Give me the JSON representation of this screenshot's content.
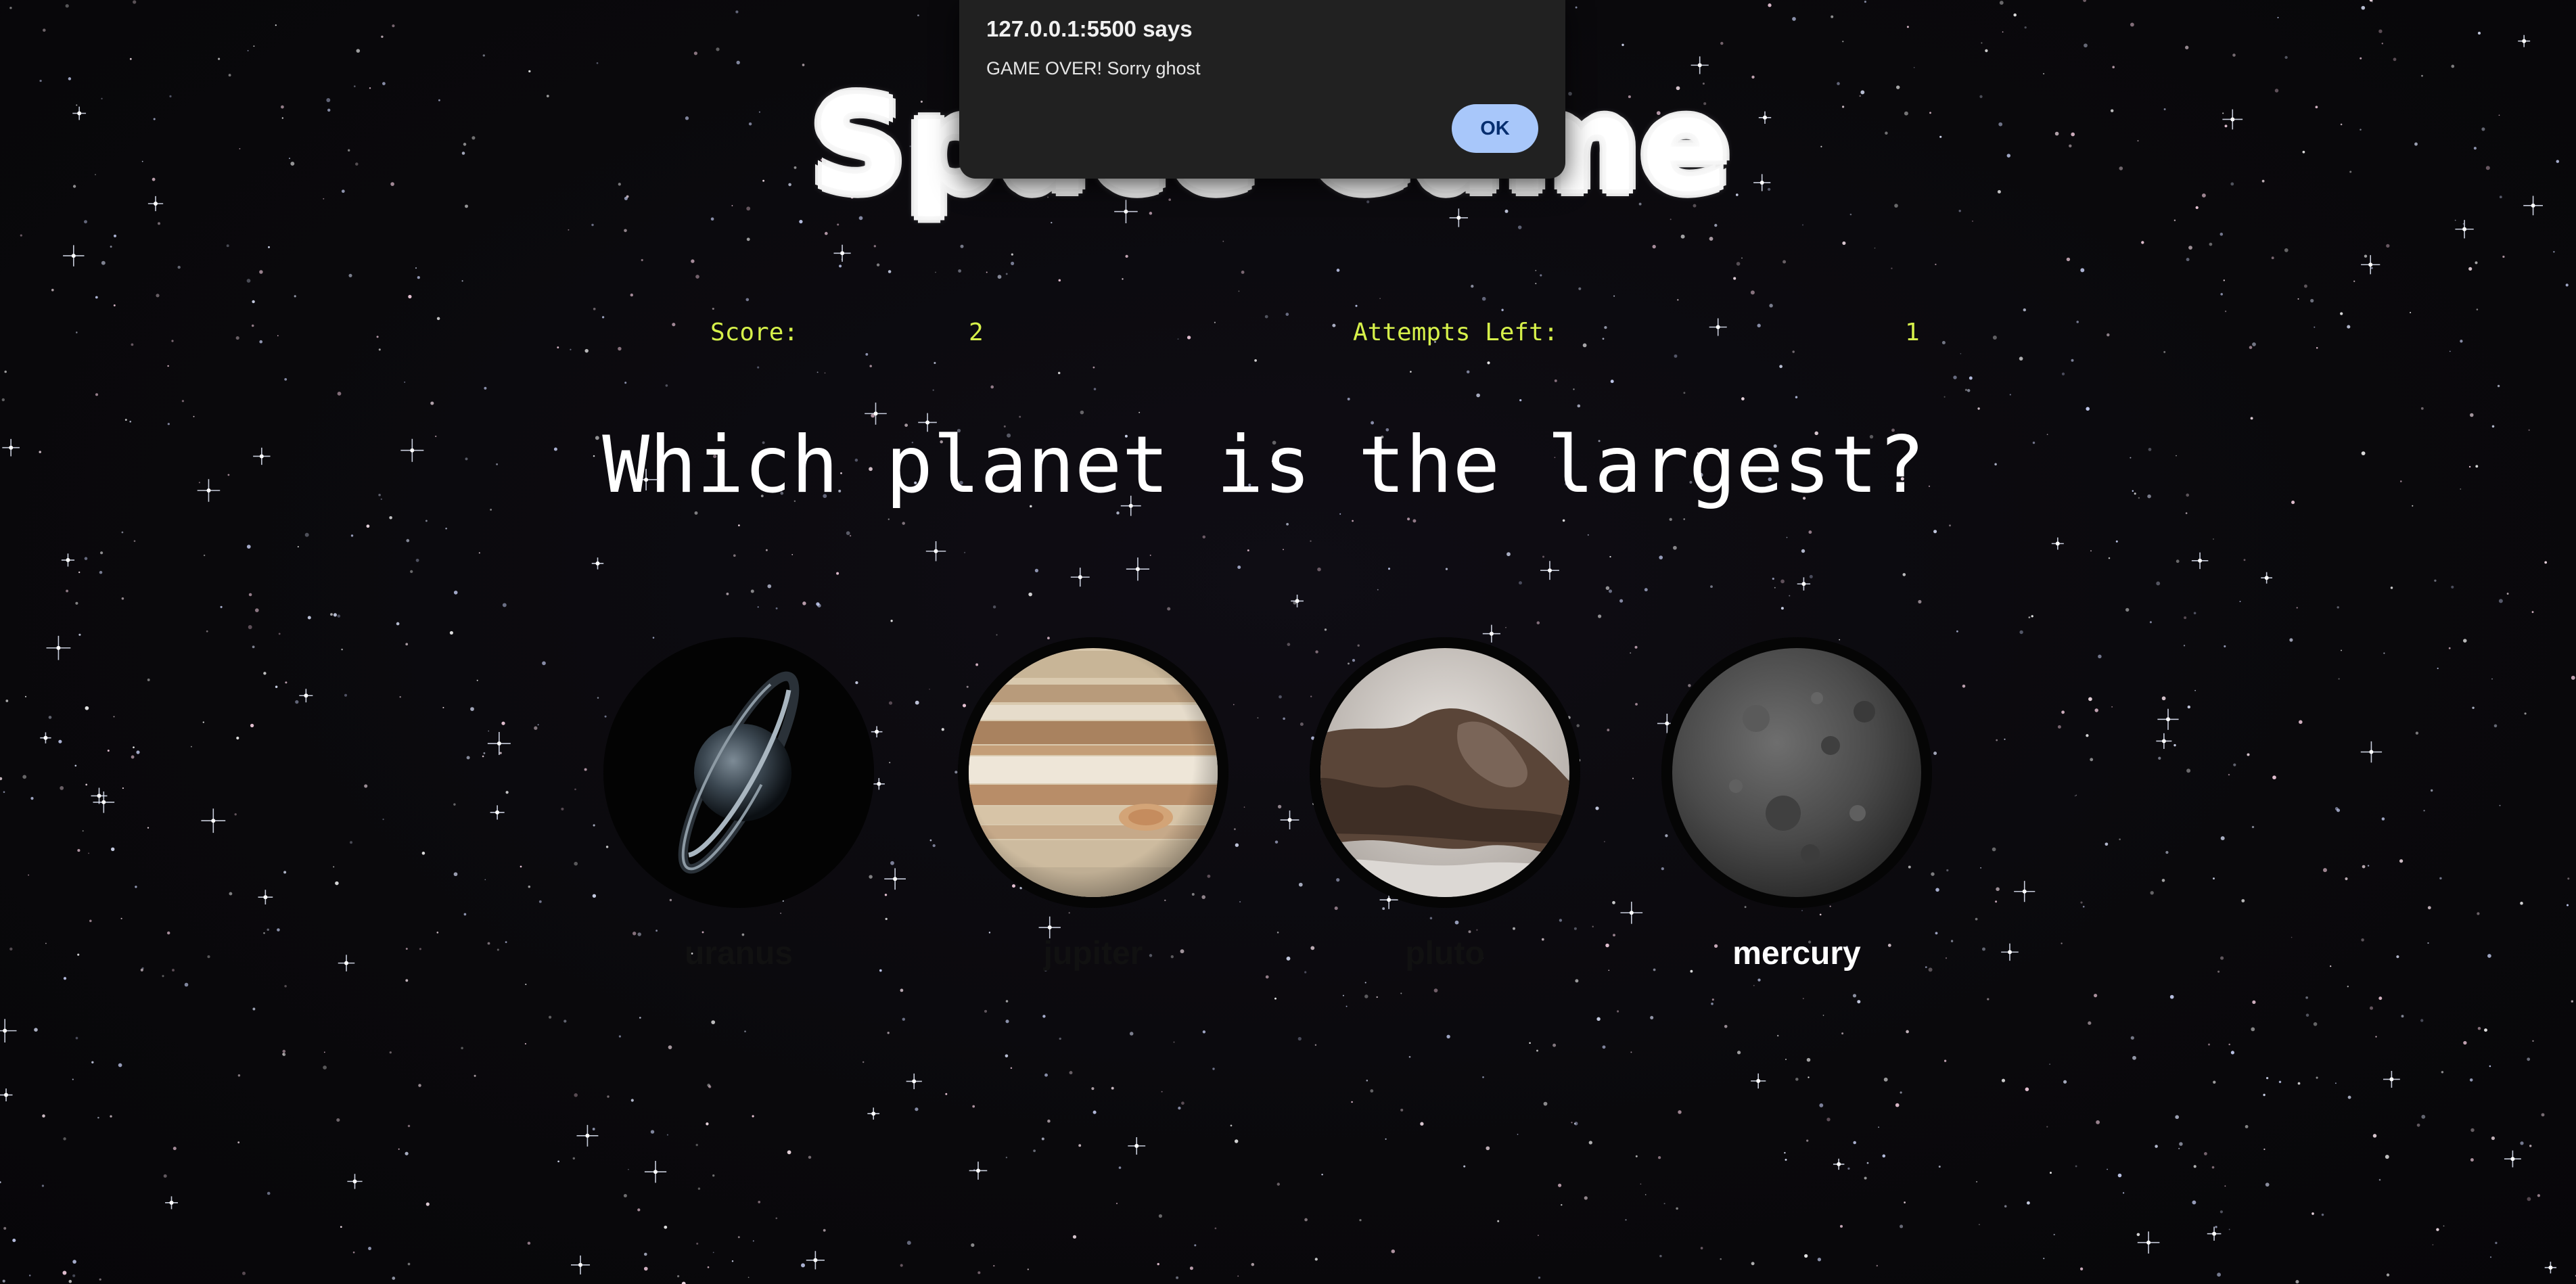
{
  "title": "Space Game",
  "stats": {
    "score_label": "Score:",
    "score_value": "2",
    "attempts_label": "Attempts Left:",
    "attempts_value": "1"
  },
  "question": "Which planet is the largest?",
  "planets": [
    {
      "name": "uranus",
      "selected": false
    },
    {
      "name": "jupiter",
      "selected": false
    },
    {
      "name": "pluto",
      "selected": false
    },
    {
      "name": "mercury",
      "selected": true
    }
  ],
  "alert": {
    "origin": "127.0.0.1:5500 says",
    "message": "GAME OVER! Sorry ghost",
    "ok_label": "OK"
  },
  "colors": {
    "background": "#0a090c",
    "stat_text": "#d6f04a",
    "dialog_bg": "#212121",
    "ok_button": "#a8c7fa"
  }
}
